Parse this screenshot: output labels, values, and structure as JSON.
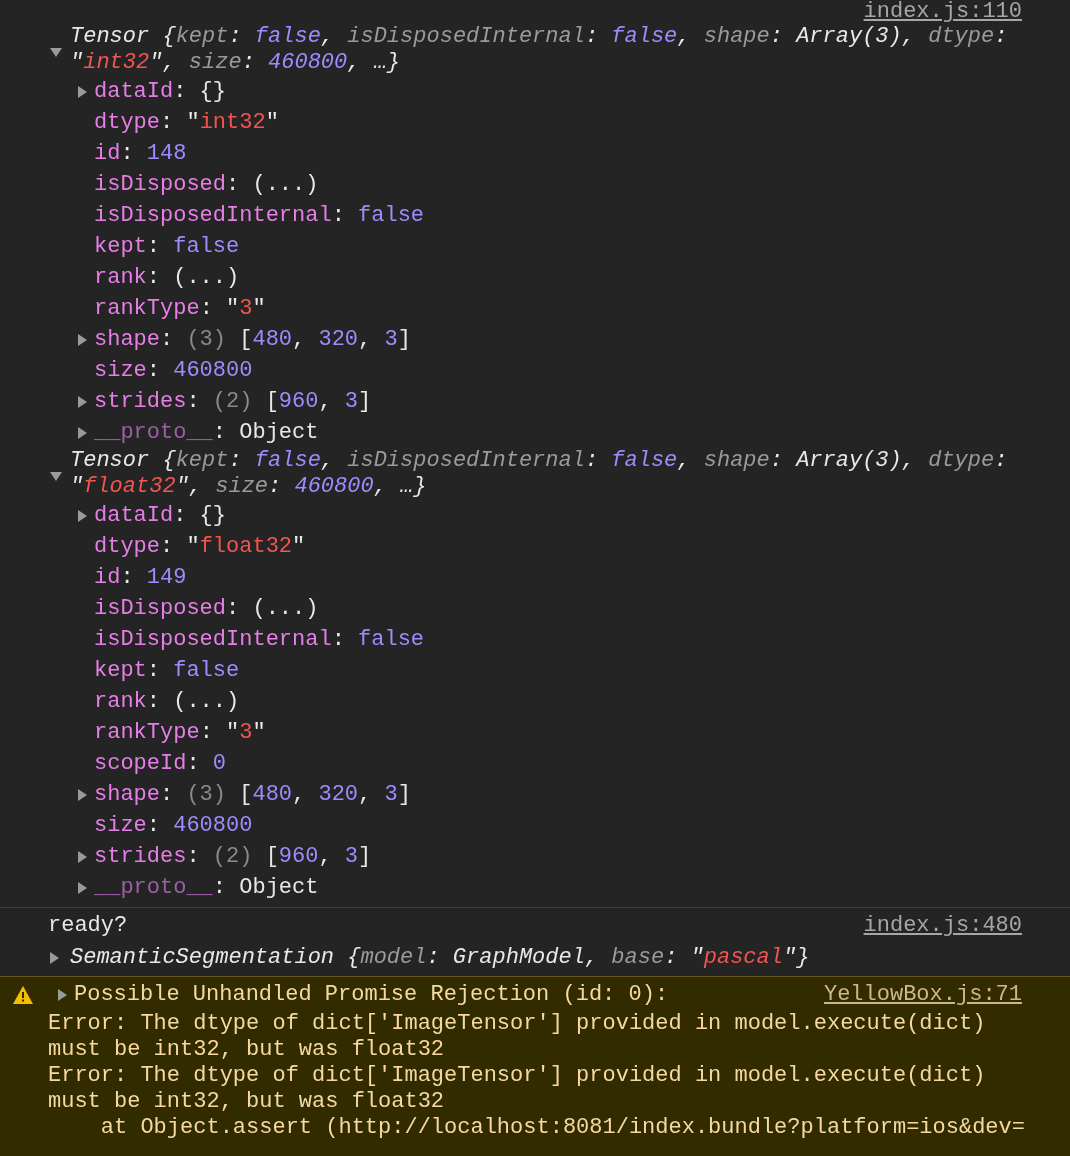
{
  "messages": [
    {
      "kind": "object",
      "source": "index.js:110",
      "expanded": true,
      "summary": [
        {
          "kind": "plain",
          "text": "Tensor {"
        },
        {
          "kind": "dimkey",
          "text": "kept"
        },
        {
          "kind": "plain",
          "text": ": "
        },
        {
          "kind": "bool",
          "text": "false"
        },
        {
          "kind": "plain",
          "text": ", "
        },
        {
          "kind": "dimkey",
          "text": "isDisposedInternal"
        },
        {
          "kind": "plain",
          "text": ": "
        },
        {
          "kind": "bool",
          "text": "false"
        },
        {
          "kind": "plain",
          "text": ", "
        },
        {
          "kind": "dimkey",
          "text": "shape"
        },
        {
          "kind": "plain",
          "text": ": Array(3), "
        },
        {
          "kind": "dimkey",
          "text": "dtype"
        },
        {
          "kind": "plain",
          "text": ": \""
        },
        {
          "kind": "str",
          "text": "int32"
        },
        {
          "kind": "plain",
          "text": "\", "
        },
        {
          "kind": "dimkey",
          "text": "size"
        },
        {
          "kind": "plain",
          "text": ": "
        },
        {
          "kind": "num",
          "text": "460800"
        },
        {
          "kind": "plain",
          "text": ", …}"
        }
      ],
      "properties": [
        {
          "expandable": true,
          "tokens": [
            {
              "kind": "key",
              "text": "dataId"
            },
            {
              "kind": "plain",
              "text": ": {}"
            }
          ]
        },
        {
          "expandable": false,
          "tokens": [
            {
              "kind": "key",
              "text": "dtype"
            },
            {
              "kind": "plain",
              "text": ": \""
            },
            {
              "kind": "str",
              "text": "int32"
            },
            {
              "kind": "plain",
              "text": "\""
            }
          ]
        },
        {
          "expandable": false,
          "tokens": [
            {
              "kind": "key",
              "text": "id"
            },
            {
              "kind": "plain",
              "text": ": "
            },
            {
              "kind": "num",
              "text": "148"
            }
          ]
        },
        {
          "expandable": false,
          "tokens": [
            {
              "kind": "key",
              "text": "isDisposed"
            },
            {
              "kind": "plain",
              "text": ": (...)"
            }
          ]
        },
        {
          "expandable": false,
          "tokens": [
            {
              "kind": "key",
              "text": "isDisposedInternal"
            },
            {
              "kind": "plain",
              "text": ": "
            },
            {
              "kind": "bool",
              "text": "false"
            }
          ]
        },
        {
          "expandable": false,
          "tokens": [
            {
              "kind": "key",
              "text": "kept"
            },
            {
              "kind": "plain",
              "text": ": "
            },
            {
              "kind": "bool",
              "text": "false"
            }
          ]
        },
        {
          "expandable": false,
          "tokens": [
            {
              "kind": "key",
              "text": "rank"
            },
            {
              "kind": "plain",
              "text": ": (...)"
            }
          ]
        },
        {
          "expandable": false,
          "tokens": [
            {
              "kind": "key",
              "text": "rankType"
            },
            {
              "kind": "plain",
              "text": ": \""
            },
            {
              "kind": "str",
              "text": "3"
            },
            {
              "kind": "plain",
              "text": "\""
            }
          ]
        },
        {
          "expandable": true,
          "tokens": [
            {
              "kind": "key",
              "text": "shape"
            },
            {
              "kind": "plain",
              "text": ": "
            },
            {
              "kind": "dim",
              "text": "(3)"
            },
            {
              "kind": "plain",
              "text": " ["
            },
            {
              "kind": "num",
              "text": "480"
            },
            {
              "kind": "plain",
              "text": ", "
            },
            {
              "kind": "num",
              "text": "320"
            },
            {
              "kind": "plain",
              "text": ", "
            },
            {
              "kind": "num",
              "text": "3"
            },
            {
              "kind": "plain",
              "text": "]"
            }
          ]
        },
        {
          "expandable": false,
          "tokens": [
            {
              "kind": "key",
              "text": "size"
            },
            {
              "kind": "plain",
              "text": ": "
            },
            {
              "kind": "num",
              "text": "460800"
            }
          ]
        },
        {
          "expandable": true,
          "tokens": [
            {
              "kind": "key",
              "text": "strides"
            },
            {
              "kind": "plain",
              "text": ": "
            },
            {
              "kind": "dim",
              "text": "(2)"
            },
            {
              "kind": "plain",
              "text": " ["
            },
            {
              "kind": "num",
              "text": "960"
            },
            {
              "kind": "plain",
              "text": ", "
            },
            {
              "kind": "num",
              "text": "3"
            },
            {
              "kind": "plain",
              "text": "]"
            }
          ]
        },
        {
          "expandable": true,
          "tokens": [
            {
              "kind": "protokey",
              "text": "__proto__"
            },
            {
              "kind": "plain",
              "text": ": Object"
            }
          ]
        }
      ]
    },
    {
      "kind": "object",
      "expanded": true,
      "summary": [
        {
          "kind": "plain",
          "text": "Tensor {"
        },
        {
          "kind": "dimkey",
          "text": "kept"
        },
        {
          "kind": "plain",
          "text": ": "
        },
        {
          "kind": "bool",
          "text": "false"
        },
        {
          "kind": "plain",
          "text": ", "
        },
        {
          "kind": "dimkey",
          "text": "isDisposedInternal"
        },
        {
          "kind": "plain",
          "text": ": "
        },
        {
          "kind": "bool",
          "text": "false"
        },
        {
          "kind": "plain",
          "text": ", "
        },
        {
          "kind": "dimkey",
          "text": "shape"
        },
        {
          "kind": "plain",
          "text": ": Array(3), "
        },
        {
          "kind": "dimkey",
          "text": "dtype"
        },
        {
          "kind": "plain",
          "text": ": \""
        },
        {
          "kind": "str",
          "text": "float32"
        },
        {
          "kind": "plain",
          "text": "\", "
        },
        {
          "kind": "dimkey",
          "text": "size"
        },
        {
          "kind": "plain",
          "text": ": "
        },
        {
          "kind": "num",
          "text": "460800"
        },
        {
          "kind": "plain",
          "text": ", …}"
        }
      ],
      "properties": [
        {
          "expandable": true,
          "tokens": [
            {
              "kind": "key",
              "text": "dataId"
            },
            {
              "kind": "plain",
              "text": ": {}"
            }
          ]
        },
        {
          "expandable": false,
          "tokens": [
            {
              "kind": "key",
              "text": "dtype"
            },
            {
              "kind": "plain",
              "text": ": \""
            },
            {
              "kind": "str",
              "text": "float32"
            },
            {
              "kind": "plain",
              "text": "\""
            }
          ]
        },
        {
          "expandable": false,
          "tokens": [
            {
              "kind": "key",
              "text": "id"
            },
            {
              "kind": "plain",
              "text": ": "
            },
            {
              "kind": "num",
              "text": "149"
            }
          ]
        },
        {
          "expandable": false,
          "tokens": [
            {
              "kind": "key",
              "text": "isDisposed"
            },
            {
              "kind": "plain",
              "text": ": (...)"
            }
          ]
        },
        {
          "expandable": false,
          "tokens": [
            {
              "kind": "key",
              "text": "isDisposedInternal"
            },
            {
              "kind": "plain",
              "text": ": "
            },
            {
              "kind": "bool",
              "text": "false"
            }
          ]
        },
        {
          "expandable": false,
          "tokens": [
            {
              "kind": "key",
              "text": "kept"
            },
            {
              "kind": "plain",
              "text": ": "
            },
            {
              "kind": "bool",
              "text": "false"
            }
          ]
        },
        {
          "expandable": false,
          "tokens": [
            {
              "kind": "key",
              "text": "rank"
            },
            {
              "kind": "plain",
              "text": ": (...)"
            }
          ]
        },
        {
          "expandable": false,
          "tokens": [
            {
              "kind": "key",
              "text": "rankType"
            },
            {
              "kind": "plain",
              "text": ": \""
            },
            {
              "kind": "str",
              "text": "3"
            },
            {
              "kind": "plain",
              "text": "\""
            }
          ]
        },
        {
          "expandable": false,
          "tokens": [
            {
              "kind": "key",
              "text": "scopeId"
            },
            {
              "kind": "plain",
              "text": ": "
            },
            {
              "kind": "num",
              "text": "0"
            }
          ]
        },
        {
          "expandable": true,
          "tokens": [
            {
              "kind": "key",
              "text": "shape"
            },
            {
              "kind": "plain",
              "text": ": "
            },
            {
              "kind": "dim",
              "text": "(3)"
            },
            {
              "kind": "plain",
              "text": " ["
            },
            {
              "kind": "num",
              "text": "480"
            },
            {
              "kind": "plain",
              "text": ", "
            },
            {
              "kind": "num",
              "text": "320"
            },
            {
              "kind": "plain",
              "text": ", "
            },
            {
              "kind": "num",
              "text": "3"
            },
            {
              "kind": "plain",
              "text": "]"
            }
          ]
        },
        {
          "expandable": false,
          "tokens": [
            {
              "kind": "key",
              "text": "size"
            },
            {
              "kind": "plain",
              "text": ": "
            },
            {
              "kind": "num",
              "text": "460800"
            }
          ]
        },
        {
          "expandable": true,
          "tokens": [
            {
              "kind": "key",
              "text": "strides"
            },
            {
              "kind": "plain",
              "text": ": "
            },
            {
              "kind": "dim",
              "text": "(2)"
            },
            {
              "kind": "plain",
              "text": " ["
            },
            {
              "kind": "num",
              "text": "960"
            },
            {
              "kind": "plain",
              "text": ", "
            },
            {
              "kind": "num",
              "text": "3"
            },
            {
              "kind": "plain",
              "text": "]"
            }
          ]
        },
        {
          "expandable": true,
          "tokens": [
            {
              "kind": "protokey",
              "text": "__proto__"
            },
            {
              "kind": "plain",
              "text": ": Object"
            }
          ]
        }
      ]
    },
    {
      "kind": "log",
      "source": "index.js:480",
      "text": "ready?",
      "object": {
        "expanded": false,
        "summary": [
          {
            "kind": "plain",
            "text": "SemanticSegmentation {"
          },
          {
            "kind": "dimkey",
            "text": "model"
          },
          {
            "kind": "plain",
            "text": ": GraphModel, "
          },
          {
            "kind": "dimkey",
            "text": "base"
          },
          {
            "kind": "plain",
            "text": ": \""
          },
          {
            "kind": "str",
            "text": "pascal"
          },
          {
            "kind": "plain",
            "text": "\"}"
          }
        ]
      }
    },
    {
      "kind": "warning",
      "source": "YellowBox.js:71",
      "expanded": false,
      "title": "Possible Unhandled Promise Rejection (id: 0):",
      "lines": [
        "Error: The dtype of dict['ImageTensor'] provided in model.execute(dict)",
        "must be int32, but was float32",
        "Error: The dtype of dict['ImageTensor'] provided in model.execute(dict)",
        "must be int32, but was float32",
        "    at Object.assert (http://localhost:8081/index.bundle?platform=ios&dev="
      ]
    }
  ]
}
